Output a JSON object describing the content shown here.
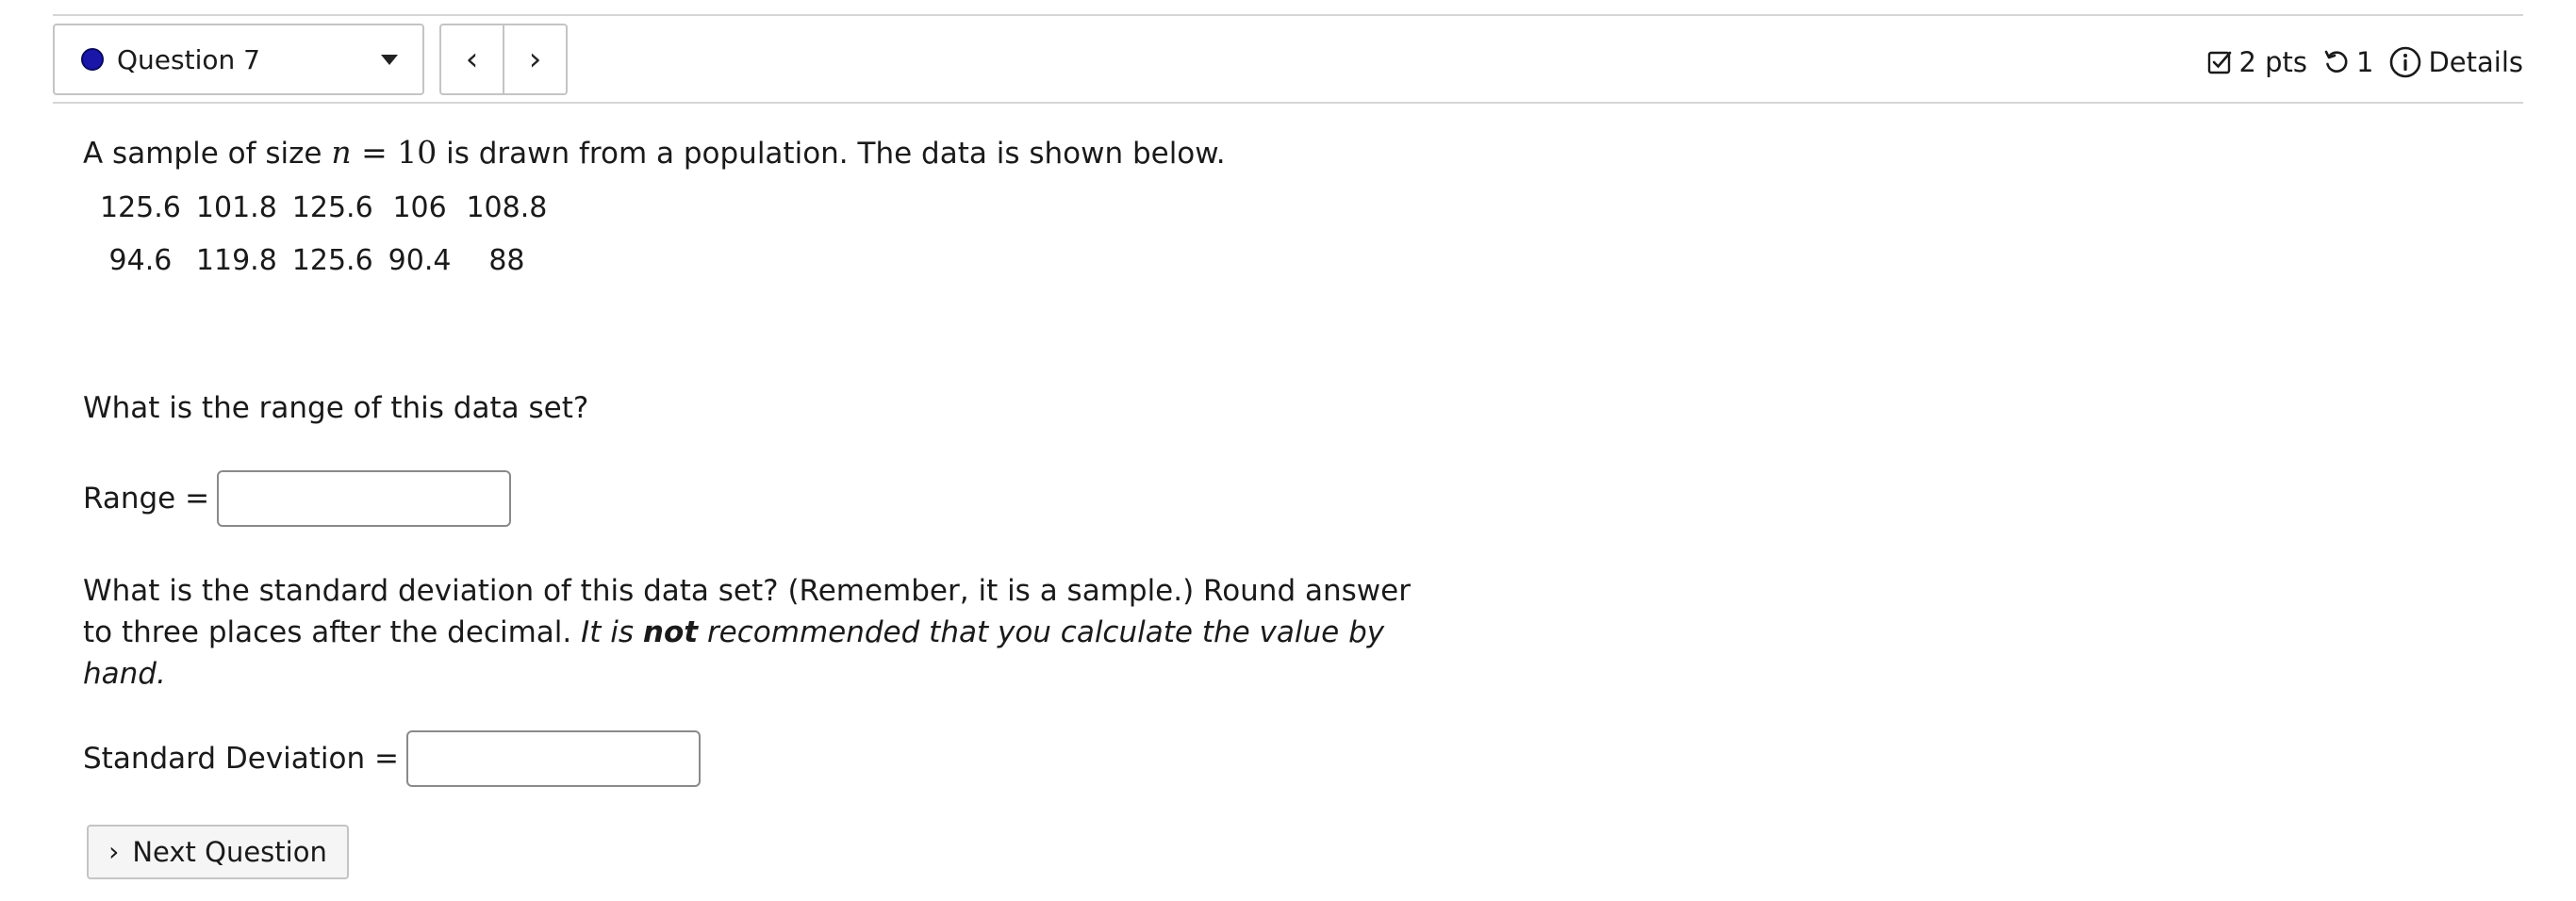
{
  "header": {
    "question_label": "Question 7",
    "prev_glyph": "‹",
    "next_glyph": "›",
    "points": "2 pts",
    "attempts": "1",
    "details_label": "Details"
  },
  "question": {
    "intro_before": "A sample of size",
    "math_var": "n",
    "math_eq": "=",
    "math_value": "10",
    "intro_after": "is drawn from a population. The data is shown below.",
    "data_rows": [
      [
        "125.6",
        "101.8",
        "125.6",
        "106",
        "108.8"
      ],
      [
        "94.6",
        "119.8",
        "125.6",
        "90.4",
        "88"
      ]
    ],
    "range_question": "What is the range of this data set?",
    "range_label": "Range =",
    "range_value": "",
    "sd_question_main": "What is the standard deviation of this data set? (Remember, it is a sample.) Round answer to three places after the decimal.",
    "sd_it_is": "It is",
    "sd_not": "not",
    "sd_rest": "recommended that you calculate the value by hand.",
    "sd_label": "Standard Deviation =",
    "sd_value": ""
  },
  "footer": {
    "next_label": "Next Question",
    "next_glyph": "›"
  },
  "colors": {
    "status_dot": "#1a17a8",
    "border": "#c4c4c4"
  }
}
